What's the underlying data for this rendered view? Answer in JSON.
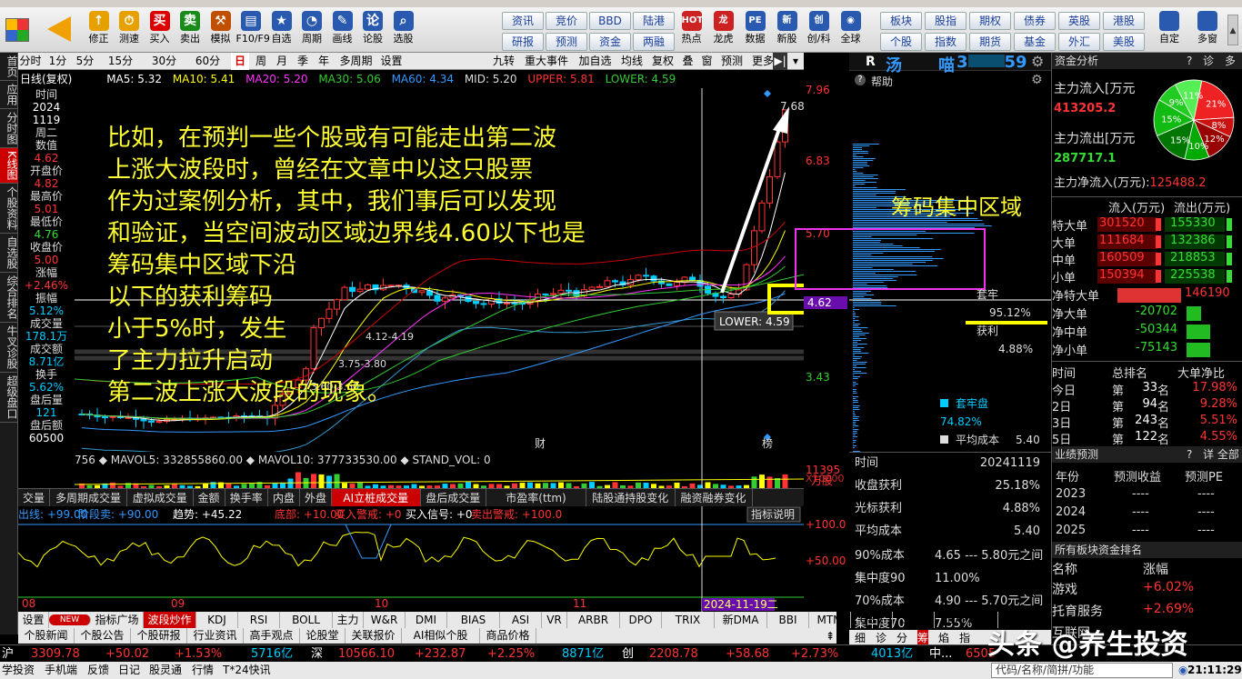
{
  "toolbar": {
    "buttons": [
      {
        "label": "修正",
        "icon": "arrow-up-icon",
        "color": "#e6a000"
      },
      {
        "label": "测速",
        "icon": "speed-icon",
        "color": "#e6a000"
      },
      {
        "label": "买入",
        "icon": "buy-icon",
        "color": "#d00"
      },
      {
        "label": "卖出",
        "icon": "sell-icon",
        "color": "#1a8a1a"
      },
      {
        "label": "模拟",
        "icon": "hammer-icon",
        "color": "#c05000"
      },
      {
        "label": "F10/F9",
        "icon": "f10-icon",
        "color": "#2a5ab0"
      },
      {
        "label": "自选",
        "icon": "star-icon",
        "color": "#2a5ab0"
      },
      {
        "label": "周期",
        "icon": "clock-icon",
        "color": "#2a5ab0"
      },
      {
        "label": "画线",
        "icon": "pen-icon",
        "color": "#2a5ab0"
      },
      {
        "label": "论股",
        "icon": "discuss-icon",
        "color": "#2a5ab0"
      },
      {
        "label": "选股",
        "icon": "search-icon",
        "color": "#2a5ab0"
      }
    ],
    "grid": [
      [
        "资讯",
        "竞价",
        "BBD",
        "陆港"
      ],
      [
        "研报",
        "预测",
        "资金",
        "两融"
      ]
    ],
    "extra": [
      {
        "label": "热点",
        "icon": "hot-icon"
      },
      {
        "label": "龙虎",
        "icon": "dragon-icon"
      },
      {
        "label": "数据",
        "icon": "pe-icon"
      },
      {
        "label": "新股",
        "icon": "newstock-icon"
      },
      {
        "label": "创/科",
        "icon": "chuang-icon"
      },
      {
        "label": "全球",
        "icon": "globe-icon"
      }
    ],
    "grid2": [
      [
        "板块",
        "股指",
        "期权",
        "债券",
        "英股",
        "港股"
      ],
      [
        "个股",
        "指数",
        "期货",
        "基金",
        "外汇",
        "美股"
      ]
    ],
    "right": [
      {
        "label": "自定"
      },
      {
        "label": "多窗"
      }
    ]
  },
  "lefttabs": [
    "首页",
    "应用",
    "分时图",
    "K线图",
    "个股资料",
    "自选股",
    "综合排名",
    "牛叉诊股",
    "超级盘口"
  ],
  "periods": [
    "分时",
    "1分",
    "5分",
    "15分",
    "30分",
    "60分",
    "日",
    "周",
    "月",
    "季",
    "年",
    "多周期",
    "设置"
  ],
  "periods_selected": "日",
  "period_right": [
    "九转",
    "重大事件",
    "加自选",
    "均线",
    "复权",
    "叠",
    "窗",
    "预测",
    "更多"
  ],
  "indicators": {
    "mode": "日线(复权)",
    "ma5": "MA5: 5.32",
    "ma10": "MA10: 5.41",
    "ma20": "MA20: 5.20",
    "ma30": "MA30: 5.06",
    "ma60": "MA60: 4.34",
    "mid": "MID: 5.20",
    "upper": "UPPER: 5.81",
    "lower": "LOWER: 4.59"
  },
  "info": [
    {
      "k": "时间",
      "v": "2024",
      "c": "white"
    },
    {
      "k": "",
      "v": "1119",
      "c": "white"
    },
    {
      "k": "周二",
      "v": "",
      "c": "white"
    },
    {
      "k": "数值",
      "v": "4.62",
      "c": "red"
    },
    {
      "k": "开盘价",
      "v": "4.82",
      "c": "red"
    },
    {
      "k": "最高价",
      "v": "5.01",
      "c": "red"
    },
    {
      "k": "最低价",
      "v": "4.76",
      "c": "green"
    },
    {
      "k": "收盘价",
      "v": "5.00",
      "c": "red"
    },
    {
      "k": "涨幅",
      "v": "+2.46%",
      "c": "red"
    },
    {
      "k": "振幅",
      "v": "5.12%",
      "c": "cyan"
    },
    {
      "k": "成交量",
      "v": "178.1万",
      "c": "cyan"
    },
    {
      "k": "成交额",
      "v": "8.71亿",
      "c": "cyan"
    },
    {
      "k": "换手",
      "v": "5.62%",
      "c": "cyan"
    },
    {
      "k": "盘后量",
      "v": "121",
      "c": "cyan"
    },
    {
      "k": "盘后额",
      "v": "60500",
      "c": "white"
    }
  ],
  "chart_data": {
    "type": "candlestick",
    "price_axis": [
      "7.96",
      "6.83",
      "5.70",
      "4.62",
      "3.43"
    ],
    "peak_label": "7.68",
    "lower_label": "LOWER: 4.59",
    "price_marker": "4.62",
    "annotations": [
      "4.12-4.19",
      "3.75-3.80",
      "3.60-3.60"
    ],
    "markers": [
      "财",
      "榜"
    ],
    "x_ticks": [
      "08",
      "09",
      "10",
      "11"
    ],
    "cursor_date": "2024-11-19二"
  },
  "overlay_text": [
    "比如，在预判一些个股或有可能走出第二波",
    "上涨大波段时，曾经在文章中以这只股票",
    "作为过案例分析，其中，我们事后可以发现",
    "和验证，当空间波动区域边界线4.60以下也是",
    "筹码集中区域下沿",
    "以下的获利筹码",
    "小于5%时，发生",
    "了主力拉升启动",
    "第二波上涨大波段的现象。"
  ],
  "chip_label": "筹码集中区域",
  "volume": {
    "line": "756 ◆ MAVOL5: 332855860.00 ◆ MAVOL10: 377733530.00 ◆ STAND_VOL: 0",
    "axis_top": "11395",
    "axis_mid": "万股",
    "axis_x": "X10000"
  },
  "subtabs": [
    "交量",
    "多周期成交量",
    "虚拟成交量",
    "金额",
    "换手率",
    "内盘",
    "外盘",
    "AI立桩成交量",
    "盘后成交量",
    "市盈率(ttm)",
    "陆股通持股变化",
    "融资融券变化"
  ],
  "subtab_selected": "AI立桩成交量",
  "indline2": {
    "a": "出线: +99.00",
    "b": "阶段卖: +90.00",
    "c": "趋势: +45.22",
    "d": "底部: +10.00",
    "e": "买入警戒: +0",
    "f": "买入信号: +0",
    "g": "卖出警戒: +100.0",
    "btn": "指标说明",
    "ax1": "+100.0",
    "ax2": "+50.00"
  },
  "bottomtabs": [
    "设置",
    "NEW",
    "指标广场",
    "波段炒作",
    "KDJ",
    "RSI",
    "BOLL",
    "主力",
    "W&R",
    "DMI",
    "BIAS",
    "ASI",
    "VR",
    "ARBR",
    "DPO",
    "TRIX",
    "新DMA",
    "BBI",
    "MTM",
    "OBV",
    "SAR",
    "EXPMA"
  ],
  "bottomtab_selected": "波段炒作",
  "bottomtabs2": [
    "个股新闻",
    "个股公告",
    "个股研报",
    "行业资讯",
    "高手观点",
    "论股堂",
    "关联报价",
    "AI相似个股",
    "商品价格"
  ],
  "status": {
    "sh": "沪",
    "sh_v": "3309.78",
    "sh_c": "+50.02",
    "sh_p": "+1.53%",
    "sh_amt": "5716亿",
    "sz": "深",
    "sz_v": "10566.10",
    "sz_c": "+232.87",
    "sz_p": "+2.25%",
    "sz_amt": "8871亿",
    "cy": "创",
    "cy_v": "2208.78",
    "cy_c": "+58.68",
    "cy_p": "+2.73%",
    "cy_amt": "4013亿",
    "tail": "中...",
    "tail_v": "6505"
  },
  "footer": [
    "学投资",
    "手机端",
    "反馈",
    "日记",
    "股灵通",
    "行情",
    "T*24快讯"
  ],
  "footer_right": {
    "search": "代码/名称/简拼/功能",
    "time": "21:11:29"
  },
  "stock_title": {
    "r": "R",
    "name": "汤",
    "name2": "喵",
    "code": "3",
    "code2": "59"
  },
  "help": "帮助",
  "chip": {
    "taolao_label": "套牢",
    "taolao": "95.12%",
    "huoli_label": "获利",
    "huoli": "4.88%",
    "legend": [
      {
        "k": "套牢盘",
        "v": "74.82%",
        "c": "#0cf"
      },
      {
        "k": "平均成本",
        "v": "5.40",
        "c": "#ddd"
      },
      {
        "k": "获利盘",
        "v": "25.18%",
        "c": "#f33"
      }
    ]
  },
  "chipinfo": [
    {
      "k": "时间",
      "v": "20241119"
    },
    {
      "k": "收盘获利",
      "v": "25.18%"
    },
    {
      "k": "光标获利",
      "v": "4.88%"
    },
    {
      "k": "平均成本",
      "v": "5.40"
    },
    {
      "k": "90%成本",
      "v": "4.65  --- 5.80元之间"
    },
    {
      "k": "集中度90",
      "v": "11.00%"
    },
    {
      "k": "70%成本",
      "v": "4.90  --- 5.70元之间"
    },
    {
      "k": "集中度70",
      "v": "7.55%"
    }
  ],
  "chiptabs": [
    "细",
    "诊",
    "分",
    "筹",
    "焰",
    "指"
  ],
  "right": {
    "header": "资金分析",
    "q": "?",
    "diag": "诊",
    "more": "多",
    "inflow_label": "主力流入[万元",
    "inflow": "413205.2",
    "outflow_label": "主力流出[万元",
    "outflow": "287717.1",
    "net_label": "主力净流入(万元):",
    "net": "125488.2",
    "pie": [
      {
        "label": "21%",
        "v": 21,
        "c": "#e22"
      },
      {
        "label": "8%",
        "v": 8,
        "c": "#c11"
      },
      {
        "label": "12%",
        "v": 12,
        "c": "#900"
      },
      {
        "label": "10%",
        "v": 10,
        "c": "#0a0"
      },
      {
        "label": "15%",
        "v": 15,
        "c": "#070"
      },
      {
        "label": "15%",
        "v": 15,
        "c": "#1b1"
      },
      {
        "label": "9%",
        "v": 9,
        "c": "#2c2"
      },
      {
        "label": "11%",
        "v": 11,
        "c": "#5e5"
      }
    ],
    "flow_hdr": [
      "流入(万元)",
      "流出(万元)"
    ],
    "flows": [
      {
        "k": "特大单",
        "in": "301520",
        "out": "155330"
      },
      {
        "k": "大单",
        "in": "111684",
        "out": "132386"
      },
      {
        "k": "中单",
        "in": "160509",
        "out": "218853"
      },
      {
        "k": "小单",
        "in": "150394",
        "out": "225538"
      }
    ],
    "nets": [
      {
        "k": "净特大单",
        "v": "146190",
        "c": "red"
      },
      {
        "k": "净大单",
        "v": "-20702",
        "c": "green"
      },
      {
        "k": "净中单",
        "v": "-50344",
        "c": "green"
      },
      {
        "k": "净小单",
        "v": "-75143",
        "c": "green"
      }
    ],
    "rank_hdr": [
      "时间",
      "总排名",
      "大单净比"
    ],
    "ranks": [
      {
        "t": "今日",
        "r1": "第",
        "r2": "33",
        "r3": "名",
        "p": "17.98%"
      },
      {
        "t": "2日",
        "r1": "第",
        "r2": "94",
        "r3": "名",
        "p": "9.28%"
      },
      {
        "t": "3日",
        "r1": "第",
        "r2": "243",
        "r3": "名",
        "p": "5.51%"
      },
      {
        "t": "5日",
        "r1": "第",
        "r2": "122",
        "r3": "名",
        "p": "4.55%"
      }
    ],
    "forecast_hdr": "业绩预测",
    "forecast_more": "详 全部",
    "forecast_cols": [
      "年份",
      "预测收益",
      "预测PE"
    ],
    "forecast": [
      {
        "y": "2023",
        "a": "----",
        "b": "----"
      },
      {
        "y": "2024",
        "a": "----",
        "b": "----"
      },
      {
        "y": "2025",
        "a": "----",
        "b": "----"
      }
    ],
    "sector_hdr": "所有板块资金排名",
    "sector_cols": [
      "名称",
      "涨幅"
    ],
    "sectors": [
      {
        "n": "游戏",
        "p": "+6.02%"
      },
      {
        "n": "托育服务",
        "p": "+2.69%"
      },
      {
        "n": "互联网",
        "p": ""
      }
    ]
  },
  "watermark": "头条 @养生投资"
}
